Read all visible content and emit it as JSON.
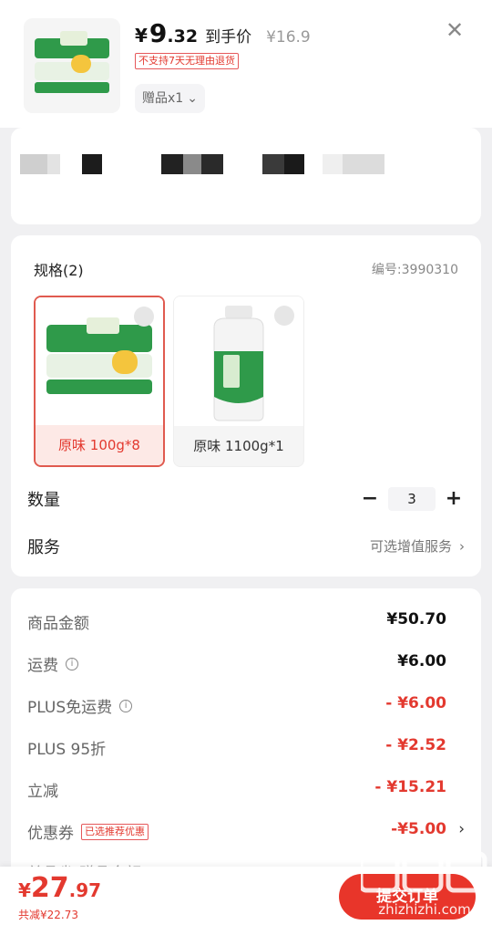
{
  "header": {
    "currency": "¥",
    "price_int": "9",
    "price_dec": ".32",
    "price_label": "到手价",
    "original_price": "¥16.9",
    "no_return_tag": "不支持7天无理由退货",
    "gift": "赠品x1",
    "close_icon": "close-icon"
  },
  "specs": {
    "title": "规格(2)",
    "code": "编号:3990310",
    "options": [
      {
        "label": "原味 100g*8",
        "selected": true
      },
      {
        "label": "原味 1100g*1",
        "selected": false
      }
    ],
    "quantity_label": "数量",
    "quantity_value": "3",
    "minus": "−",
    "plus": "+",
    "service_label": "服务",
    "service_hint": "可选增值服务",
    "chevron": "›"
  },
  "summary": {
    "rows": [
      {
        "label": "商品金额",
        "value": "¥50.70",
        "info": false,
        "discount": false
      },
      {
        "label": "运费",
        "value": "¥6.00",
        "info": true,
        "discount": false
      },
      {
        "label": "PLUS免运费",
        "value": "- ¥6.00",
        "info": true,
        "discount": true
      },
      {
        "label": "PLUS 95折",
        "value": "- ¥2.52",
        "info": false,
        "discount": true
      },
      {
        "label": "立减",
        "value": "- ¥15.21",
        "info": false,
        "discount": true
      },
      {
        "label": "优惠券",
        "value": "-¥5.00",
        "info": false,
        "discount": true
      }
    ],
    "coupon_tag": "已选推荐优惠",
    "coupon_chevron": "›",
    "partial_row": "单品省/赠品金额"
  },
  "bottom": {
    "currency": "¥",
    "total_int": "27",
    "total_dec": ".97",
    "saved": "共减¥22.73",
    "submit": "提交订单"
  },
  "watermark": {
    "text": "值 什么值得买",
    "domain": "zhizhizhi.com"
  },
  "colors": {
    "accent": "#e3392f",
    "submit_bg": "#e8352a",
    "card_bg": "#ffffff",
    "page_bg": "#f0f0f2"
  }
}
